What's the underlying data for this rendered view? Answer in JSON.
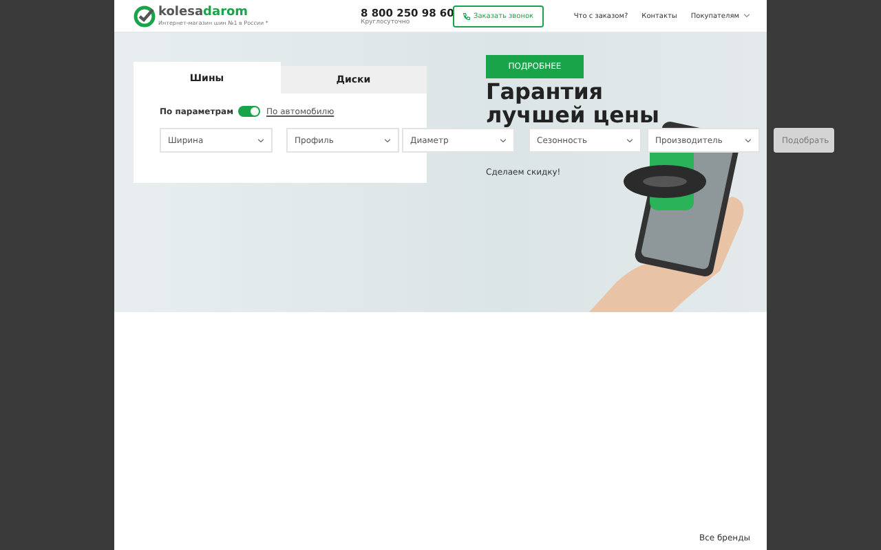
{
  "header": {
    "logo": {
      "part_1": "kolesa",
      "part_2": "darom",
      "tagline": "Интернет-магазин шин №1 в России *"
    },
    "phone": {
      "number": "8 800 250 98 60",
      "note": "Круглосуточно"
    },
    "callback_button": "Заказать звонок",
    "nav": [
      {
        "label": "Что с заказом?",
        "dropdown": false
      },
      {
        "label": "Контакты",
        "dropdown": false
      },
      {
        "label": "Покупателям",
        "dropdown": true
      }
    ]
  },
  "search": {
    "tabs": [
      {
        "label": "Шины",
        "selected": true
      },
      {
        "label": "Диски",
        "selected": false
      }
    ],
    "mode_label": "По параметрам",
    "mode_toggle": {
      "on": true
    },
    "alt_mode_link": "По автомобилю",
    "selects": [
      {
        "placeholder": "Ширина"
      },
      {
        "placeholder": "Профиль"
      },
      {
        "placeholder": "Диаметр"
      },
      {
        "placeholder": "Сезонность"
      },
      {
        "placeholder": "Производитель"
      }
    ],
    "submit_button": {
      "label": "Подобрать",
      "disabled": true
    }
  },
  "promo": {
    "button": "ПОДРОБНЕЕ",
    "headline": [
      "Гарантия",
      "лучшей цены"
    ],
    "subtitle": "Сделаем скидку!"
  },
  "footer_link": "Все бренды"
}
